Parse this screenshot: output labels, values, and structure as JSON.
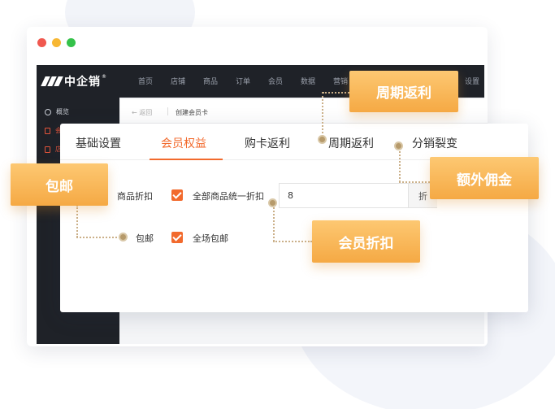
{
  "window": {
    "logo": "中企销",
    "logo_mark": "®",
    "nav": [
      "首页",
      "店铺",
      "商品",
      "订单",
      "会员",
      "数据",
      "营销",
      "设置"
    ],
    "sidebar": [
      {
        "label": "概览",
        "icon": "clock-icon"
      },
      {
        "label": "会",
        "icon": "doc-icon"
      },
      {
        "label": "店",
        "icon": "doc-icon"
      }
    ],
    "subheader": {
      "back": "← 返回",
      "title": "创建会员卡"
    }
  },
  "tabs": [
    {
      "label": "基础设置",
      "active": false
    },
    {
      "label": "会员权益",
      "active": true
    },
    {
      "label": "购卡返利",
      "active": false
    },
    {
      "label": "周期返利",
      "active": false
    },
    {
      "label": "分销裂变",
      "active": false
    }
  ],
  "form": {
    "discount_label": "商品折扣",
    "discount_check_label": "全部商品统一折扣",
    "discount_value": "8",
    "discount_suffix": "折",
    "shipping_label": "包邮",
    "shipping_check_label": "全场包邮"
  },
  "callouts": {
    "periodic_rebate": "周期返利",
    "extra_commission": "额外佣金",
    "free_shipping": "包邮",
    "member_discount": "会员折扣"
  },
  "colors": {
    "accent": "#f26a2d",
    "callout": "#f5a944",
    "dark_nav": "#1f2228"
  }
}
